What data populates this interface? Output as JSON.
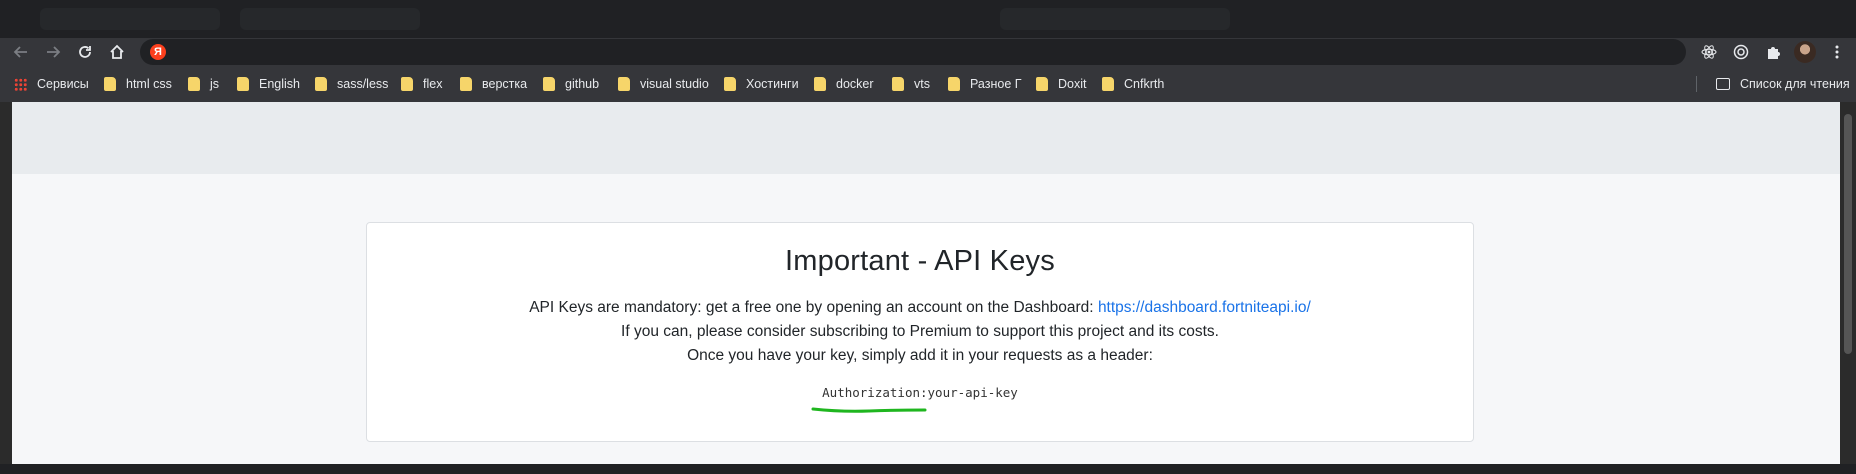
{
  "browser": {
    "address_bar": {
      "value": "",
      "site_badge": "Я"
    },
    "bookmarks": [
      {
        "label": "Сервисы",
        "type": "apps"
      },
      {
        "label": "html css",
        "type": "folder"
      },
      {
        "label": "js",
        "type": "folder"
      },
      {
        "label": "English",
        "type": "folder"
      },
      {
        "label": "sass/less",
        "type": "folder"
      },
      {
        "label": "flex",
        "type": "folder"
      },
      {
        "label": "верстка",
        "type": "folder"
      },
      {
        "label": "github",
        "type": "folder"
      },
      {
        "label": "visual studio",
        "type": "folder"
      },
      {
        "label": "Хостинги",
        "type": "folder"
      },
      {
        "label": "docker",
        "type": "folder"
      },
      {
        "label": "vts",
        "type": "folder"
      },
      {
        "label": "Разное Г",
        "type": "folder"
      },
      {
        "label": "Doxit",
        "type": "folder"
      },
      {
        "label": "Cnfkrth",
        "type": "folder"
      }
    ],
    "reading_list": {
      "label": "Список для чтения"
    },
    "extensions": [
      "react-icon",
      "target-icon",
      "puzzle-icon"
    ]
  },
  "page": {
    "title": "Important - API Keys",
    "line1_text": "API Keys are mandatory: get a free one by opening an account on the Dashboard:",
    "line1_link": "https://dashboard.fortniteapi.io/",
    "line2": "If you can, please consider subscribing to Premium to support this project and its costs.",
    "line3": "Once you have your key, simply add it in your requests as a header:",
    "code": "Authorization:your-api-key"
  },
  "colors": {
    "link": "#1a73e8",
    "annotation": "#1fb61f",
    "favicon": "#fc3f1d"
  }
}
